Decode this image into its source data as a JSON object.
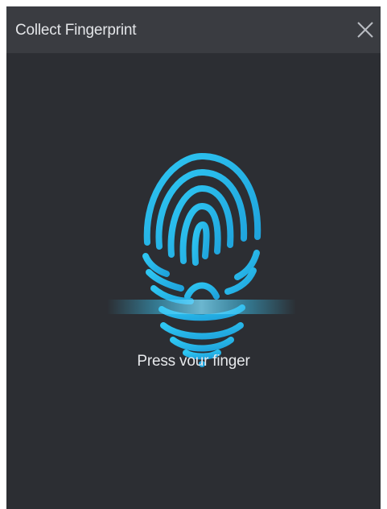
{
  "dialog": {
    "title": "Collect Fingerprint",
    "close_icon": "close-icon"
  },
  "main": {
    "fingerprint_icon": "fingerprint-icon",
    "status_text": "Press vour finger"
  },
  "colors": {
    "background": "#2c2e33",
    "titlebar": "#3a3c41",
    "accent": "#29b6e8",
    "text": "#e6e8eb"
  }
}
